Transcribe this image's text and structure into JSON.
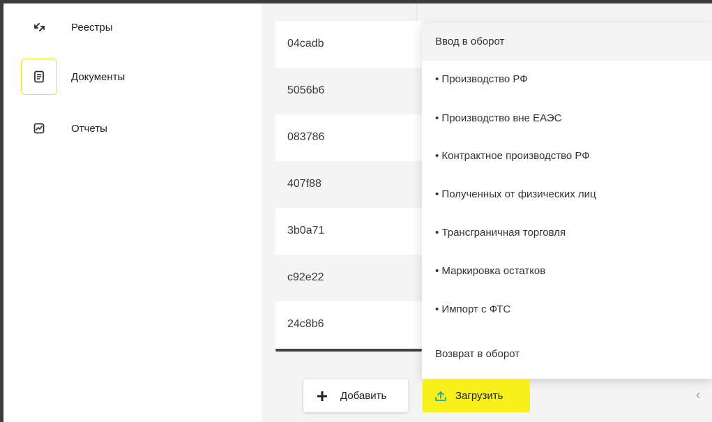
{
  "sidebar": {
    "items": [
      {
        "label": "Реестры",
        "icon": "arrows-exchange-icon",
        "active": false
      },
      {
        "label": "Документы",
        "icon": "document-icon",
        "active": true
      },
      {
        "label": "Отчеты",
        "icon": "report-chart-icon",
        "active": false
      }
    ]
  },
  "table": {
    "rows": [
      "04cadb",
      "5056b6",
      "083786",
      "407f88",
      "3b0a71",
      "c92e22",
      "24c8b6"
    ]
  },
  "dropdown": {
    "items": [
      {
        "label": "Ввод в оборот",
        "highlighted": true
      },
      {
        "label": "• Производство РФ"
      },
      {
        "label": "• Производство вне ЕАЭС"
      },
      {
        "label": "• Контрактное производство РФ"
      },
      {
        "label": "• Полученных от физических лиц"
      },
      {
        "label": "• Трансграничная торговля"
      },
      {
        "label": "• Маркировка остатков"
      },
      {
        "label": "• Импорт с ФТС"
      },
      {
        "label": "Возврат в оборот"
      }
    ]
  },
  "buttons": {
    "add_label": "Добавить",
    "upload_label": "Загрузить"
  },
  "colors": {
    "accent": "#f7f01b",
    "active_border": "#f3e51a",
    "upload_icon": "#19a8b0",
    "row_alt": "#f4f4f5"
  }
}
